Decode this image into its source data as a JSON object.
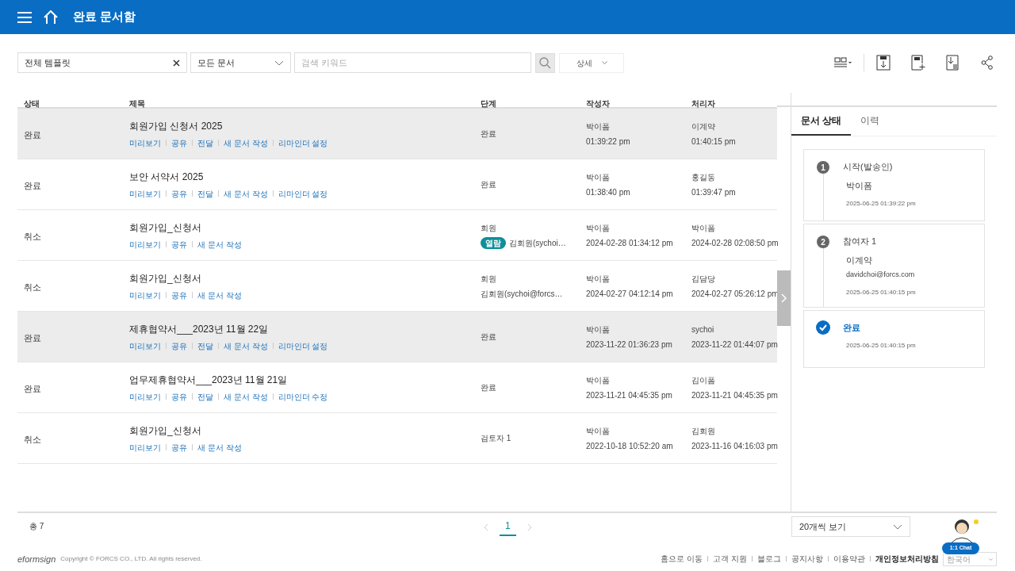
{
  "header": {
    "title": "완료 문서함"
  },
  "filters": {
    "template": "전체 템플릿",
    "doc_type": "모든 문서",
    "search_placeholder": "검색 키워드",
    "detail": "상세"
  },
  "table": {
    "columns": [
      "상태",
      "제목",
      "단계",
      "작성자",
      "처리자"
    ],
    "rows": [
      {
        "status": "완료",
        "title": "회원가입 신청서 2025",
        "actions": [
          "미리보기",
          "공유",
          "전달",
          "새 문서 작성",
          "리마인더 설정"
        ],
        "stage": "완료",
        "author": "박이폼",
        "author_time": "01:39:22 pm",
        "handler": "이계약",
        "handler_time": "01:40:15 pm",
        "selected": true
      },
      {
        "status": "완료",
        "title": "보안 서약서 2025",
        "actions": [
          "미리보기",
          "공유",
          "전달",
          "새 문서 작성",
          "리마인더 설정"
        ],
        "stage": "완료",
        "author": "박이폼",
        "author_time": "01:38:40 pm",
        "handler": "홍길동",
        "handler_time": "01:39:47 pm",
        "selected": false
      },
      {
        "status": "취소",
        "title": "회원가입_신청서",
        "actions": [
          "미리보기",
          "공유",
          "새 문서 작성"
        ],
        "stage": "회원",
        "stage_badge": "열람",
        "stage_detail": "김회원(sychoi…",
        "author": "박이폼",
        "author_time": "2024-02-28 01:34:12 pm",
        "handler": "박이폼",
        "handler_time": "2024-02-28 02:08:50 pm",
        "selected": false
      },
      {
        "status": "취소",
        "title": "회원가입_신청서",
        "actions": [
          "미리보기",
          "공유",
          "새 문서 작성"
        ],
        "stage": "회원",
        "stage_detail": "김회원(sychoi@forcs…",
        "author": "박이폼",
        "author_time": "2024-02-27 04:12:14 pm",
        "handler": "김담당",
        "handler_time": "2024-02-27 05:26:12 pm",
        "selected": false
      },
      {
        "status": "완료",
        "title": "제휴협약서___2023년 11월 22일",
        "actions": [
          "미리보기",
          "공유",
          "전달",
          "새 문서 작성",
          "리마인더 설정"
        ],
        "stage": "완료",
        "author": "박이폼",
        "author_time": "2023-11-22 01:36:23 pm",
        "handler": "sychoi",
        "handler_time": "2023-11-22 01:44:07 pm",
        "selected": true
      },
      {
        "status": "완료",
        "title": "업무제휴협약서___2023년 11월 21일",
        "actions": [
          "미리보기",
          "공유",
          "전달",
          "새 문서 작성",
          "리마인더 수정"
        ],
        "stage": "완료",
        "author": "박이폼",
        "author_time": "2023-11-21 04:45:35 pm",
        "handler": "김이폼",
        "handler_time": "2023-11-21 04:45:35 pm",
        "selected": false
      },
      {
        "status": "취소",
        "title": "회원가입_신청서",
        "actions": [
          "미리보기",
          "공유",
          "새 문서 작성"
        ],
        "stage": "검토자 1",
        "author": "박이폼",
        "author_time": "2022-10-18 10:52:20 am",
        "handler": "김회원",
        "handler_time": "2023-11-16 04:16:03 pm",
        "selected": false
      }
    ]
  },
  "side_panel": {
    "tabs": [
      {
        "label": "문서 상태",
        "selected": true
      },
      {
        "label": "이력",
        "selected": false
      }
    ],
    "steps": [
      {
        "kind": "number",
        "marker": "1",
        "title": "시작(발송인)",
        "name": "박이폼",
        "time": "2025-06-25 01:39:22 pm"
      },
      {
        "kind": "number",
        "marker": "2",
        "title": "참여자 1",
        "name": "이계약",
        "email": "davidchoi@forcs.com",
        "time": "2025-06-25 01:40:15 pm"
      },
      {
        "kind": "done",
        "title": "완료",
        "time": "2025-06-25 01:40:15 pm"
      }
    ]
  },
  "pagination": {
    "total": "총 7",
    "pages": [
      {
        "label": "1",
        "selected": true
      }
    ],
    "page_size": "20개씩 보기"
  },
  "footer": {
    "logo": "eformsign",
    "copyright": "Copyright © FORCS CO., LTD. All rights reserved.",
    "links": [
      {
        "label": "홈으로 이동",
        "bold": false
      },
      {
        "label": "고객 지원",
        "bold": false
      },
      {
        "label": "블로그",
        "bold": false
      },
      {
        "label": "공지사항",
        "bold": false
      },
      {
        "label": "이용약관",
        "bold": false
      },
      {
        "label": "개인정보처리방침",
        "bold": true
      }
    ],
    "language": "한국어"
  },
  "chat": {
    "label": "1:1 Chat"
  }
}
